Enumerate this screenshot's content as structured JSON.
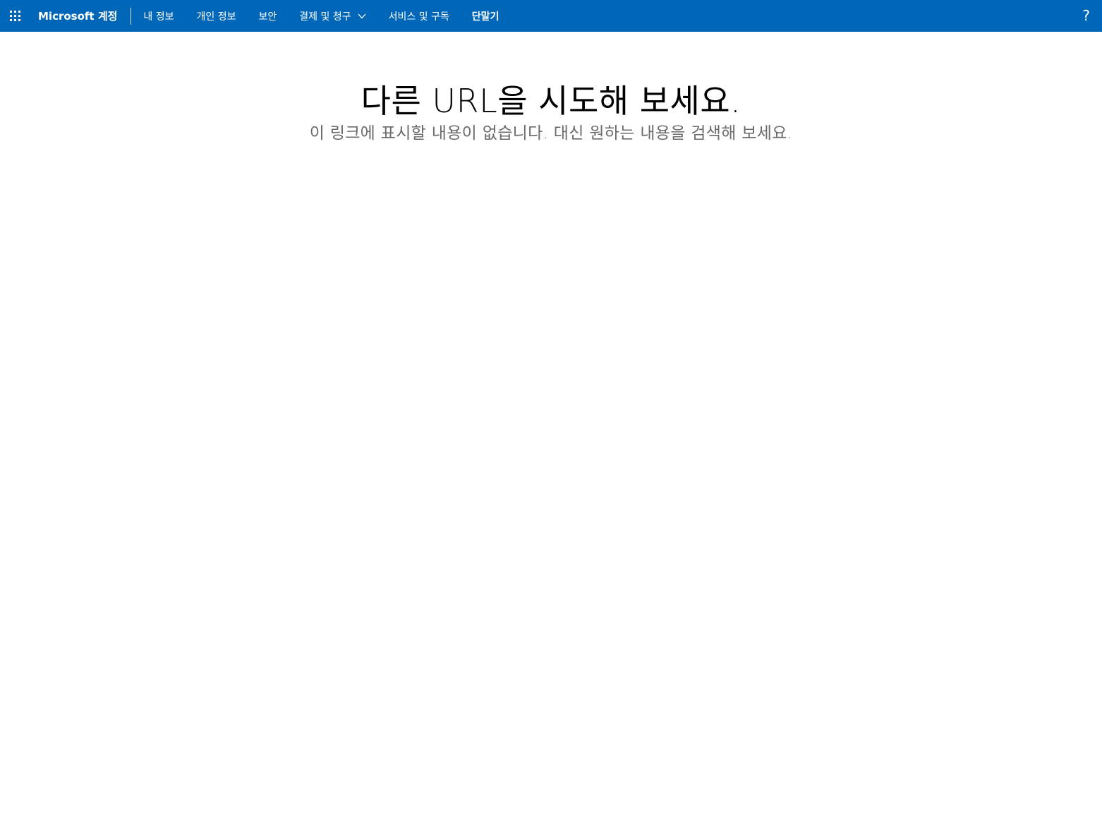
{
  "header": {
    "app_launcher_icon": "waffle-grid-icon",
    "brand": "Microsoft 계정",
    "nav": [
      {
        "label": "내 정보",
        "bold": false
      },
      {
        "label": "개인 정보",
        "bold": false
      },
      {
        "label": "보안",
        "bold": false
      },
      {
        "label": "결제 및 청구",
        "bold": false,
        "dropdown": true
      },
      {
        "label": "서비스 및 구독",
        "bold": false
      },
      {
        "label": "단말기",
        "bold": true
      }
    ],
    "help_label": "?",
    "bar_color": "#0067b8"
  },
  "main": {
    "title": "다른 URL을 시도해 보세요.",
    "subtitle": "이 링크에 표시할 내용이 없습니다. 대신 원하는 내용을 검색해 보세요."
  }
}
